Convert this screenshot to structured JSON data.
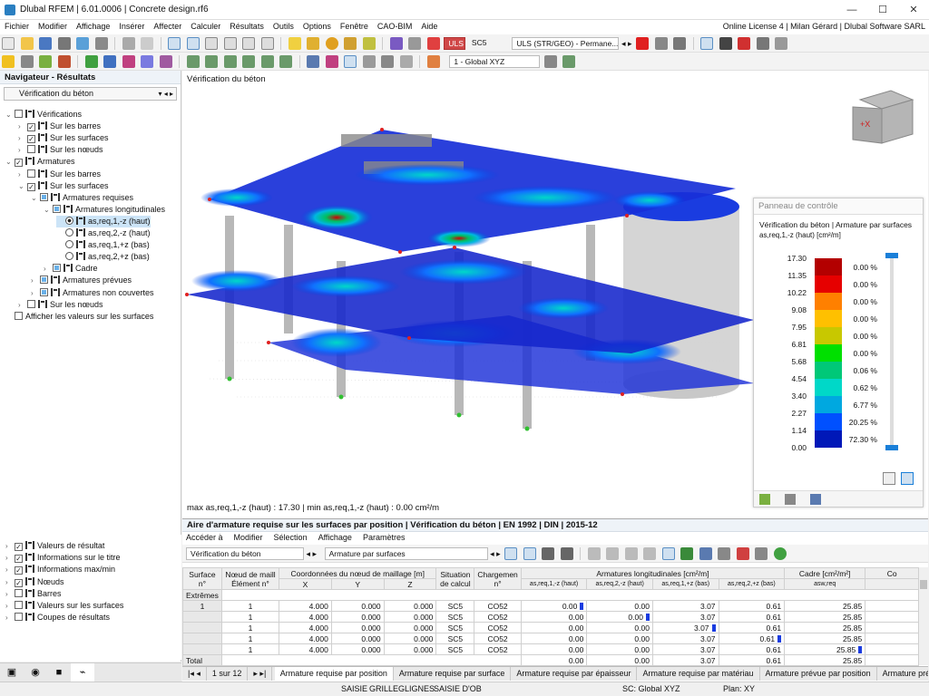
{
  "window": {
    "title": "Dlubal RFEM | 6.01.0006 | Concrete design.rf6",
    "license": "Online License 4 | Milan Gérard | Dlubal Software SARL"
  },
  "menu": [
    "Fichier",
    "Modifier",
    "Affichage",
    "Insérer",
    "Affecter",
    "Calculer",
    "Résultats",
    "Outils",
    "Options",
    "Fenêtre",
    "CAO-BIM",
    "Aide"
  ],
  "toolbar": {
    "uls_badge": "ULS",
    "sc": "SC5",
    "combo": "ULS (STR/GEO) - Permane...",
    "coord_system": "1 - Global XYZ"
  },
  "navigator": {
    "title": "Navigateur - Résultats",
    "selector": "Vérification du béton",
    "tree": [
      {
        "label": "Vérifications",
        "lvl": 0,
        "exp": "v",
        "chk": "off",
        "icon": true
      },
      {
        "label": "Sur les barres",
        "lvl": 1,
        "exp": ">",
        "chk": "on",
        "icon": true
      },
      {
        "label": "Sur les surfaces",
        "lvl": 1,
        "exp": ">",
        "chk": "on",
        "icon": true
      },
      {
        "label": "Sur les nœuds",
        "lvl": 1,
        "exp": ">",
        "chk": "off",
        "icon": true
      },
      {
        "label": "Armatures",
        "lvl": 0,
        "exp": "v",
        "chk": "on",
        "icon": true
      },
      {
        "label": "Sur les barres",
        "lvl": 1,
        "exp": ">",
        "chk": "off",
        "icon": true
      },
      {
        "label": "Sur les surfaces",
        "lvl": 1,
        "exp": "v",
        "chk": "on",
        "icon": true
      },
      {
        "label": "Armatures requises",
        "lvl": 2,
        "exp": "v",
        "chk": "part",
        "icon": true
      },
      {
        "label": "Armatures longitudinales",
        "lvl": 3,
        "exp": "v",
        "chk": "part",
        "icon": true
      },
      {
        "label": "as,req,1,-z (haut)",
        "lvl": 4,
        "radio": "on",
        "icon": true,
        "sel": true
      },
      {
        "label": "as,req,2,-z (haut)",
        "lvl": 4,
        "radio": "off",
        "icon": true
      },
      {
        "label": "as,req,1,+z (bas)",
        "lvl": 4,
        "radio": "off",
        "icon": true
      },
      {
        "label": "as,req,2,+z (bas)",
        "lvl": 4,
        "radio": "off",
        "icon": true
      },
      {
        "label": "Cadre",
        "lvl": 3,
        "exp": ">",
        "chk": "part",
        "icon": true
      },
      {
        "label": "Armatures prévues",
        "lvl": 2,
        "exp": ">",
        "chk": "part",
        "icon": true
      },
      {
        "label": "Armatures non couvertes",
        "lvl": 2,
        "exp": ">",
        "chk": "part",
        "icon": true
      },
      {
        "label": "Sur les nœuds",
        "lvl": 1,
        "exp": ">",
        "chk": "off",
        "icon": true
      },
      {
        "label": "Afficher les valeurs sur les surfaces",
        "lvl": 0,
        "exp": "",
        "chk": "off",
        "icon": false
      }
    ],
    "bottom": [
      {
        "label": "Valeurs de résultat",
        "chk": "on"
      },
      {
        "label": "Informations sur le titre",
        "chk": "on"
      },
      {
        "label": "Informations max/min",
        "chk": "on"
      },
      {
        "label": "Nœuds",
        "chk": "on"
      },
      {
        "label": "Barres",
        "chk": "off"
      },
      {
        "label": "Valeurs sur les surfaces",
        "chk": "off"
      },
      {
        "label": "Coupes de résultats",
        "chk": "off"
      }
    ]
  },
  "viewport": {
    "label": "Vérification du béton",
    "maxmin": "max as,req,1,-z (haut) : 17.30 | min as,req,1,-z (haut) : 0.00 cm²/m"
  },
  "control_panel": {
    "title": "Panneau de contrôle",
    "subtitle": "Vérification du béton | Armature par surfaces",
    "quantity": "as,req,1,-z (haut) [cm²/m]",
    "legend": [
      {
        "value": "17.30",
        "color": "#b30000",
        "pct": "0.00 %"
      },
      {
        "value": "11.35",
        "color": "#e60000",
        "pct": "0.00 %"
      },
      {
        "value": "10.22",
        "color": "#ff8000",
        "pct": "0.00 %"
      },
      {
        "value": "9.08",
        "color": "#ffc000",
        "pct": "0.00 %"
      },
      {
        "value": "7.95",
        "color": "#c8c800",
        "pct": "0.00 %"
      },
      {
        "value": "6.81",
        "color": "#00e000",
        "pct": "0.00 %"
      },
      {
        "value": "5.68",
        "color": "#00c878",
        "pct": "0.06 %"
      },
      {
        "value": "4.54",
        "color": "#00d8c8",
        "pct": "0.62 %"
      },
      {
        "value": "3.40",
        "color": "#00a8e0",
        "pct": "6.77 %"
      },
      {
        "value": "2.27",
        "color": "#0050ff",
        "pct": "20.25 %"
      },
      {
        "value": "1.14",
        "color": "#0018b8",
        "pct": "72.30 %"
      },
      {
        "value": "0.00",
        "color": "",
        "pct": ""
      }
    ]
  },
  "table_panel": {
    "title": "Aire d'armature requise sur les surfaces par position | Vérification du béton | EN 1992 | DIN | 2015-12",
    "menu": [
      "Accéder à",
      "Modifier",
      "Sélection",
      "Affichage",
      "Paramètres"
    ],
    "select1": "Vérification du béton",
    "select2": "Armature par surfaces",
    "headers": {
      "surface": "Surface n°",
      "node": "Nœud de maill Élément n°",
      "coords": "Coordonnées du nœud de maillage [m]",
      "x": "X",
      "y": "Y",
      "z": "Z",
      "situation": "Situation de calcul",
      "loading": "Chargemen n°",
      "long": "Armatures longitudinales [cm²/m]",
      "a1": "as,req,1,-z (haut)",
      "a2": "as,req,2,-z (haut)",
      "a3": "as,req,1,+z (bas)",
      "a4": "as,req,2,+z (bas)",
      "cadre": "Cadre [cm²/m²]",
      "asw": "asw,req",
      "co": "Co"
    },
    "group": {
      "label": "Extrêmes",
      "surface": "1"
    },
    "rows": [
      [
        "1",
        "4.000",
        "0.000",
        "0.000",
        "SC5",
        "CO52",
        "0.00",
        "0.00",
        "3.07",
        "0.61",
        "25.85"
      ],
      [
        "1",
        "4.000",
        "0.000",
        "0.000",
        "SC5",
        "CO52",
        "0.00",
        "0.00",
        "3.07",
        "0.61",
        "25.85"
      ],
      [
        "1",
        "4.000",
        "0.000",
        "0.000",
        "SC5",
        "CO52",
        "0.00",
        "0.00",
        "3.07",
        "0.61",
        "25.85"
      ],
      [
        "1",
        "4.000",
        "0.000",
        "0.000",
        "SC5",
        "CO52",
        "0.00",
        "0.00",
        "3.07",
        "0.61",
        "25.85"
      ],
      [
        "1",
        "4.000",
        "0.000",
        "0.000",
        "SC5",
        "CO52",
        "0.00",
        "0.00",
        "3.07",
        "0.61",
        "25.85"
      ]
    ],
    "total": {
      "label": "Total",
      "a1": "0.00",
      "a2": "0.00",
      "a3": "3.07",
      "a4": "0.61",
      "cadre": "25.85"
    },
    "pager": "1 sur 12",
    "tabs": [
      "Armature requise par position",
      "Armature requise par surface",
      "Armature requise par épaisseur",
      "Armature requise par matériau",
      "Armature prévue par position",
      "Armature prévue pa"
    ]
  },
  "statusbar": {
    "items": [
      "SAISIE",
      "GRILLE",
      "GLIGNES",
      "SAISIE D'OB"
    ],
    "cs": "SC: Global XYZ",
    "plan": "Plan: XY"
  }
}
